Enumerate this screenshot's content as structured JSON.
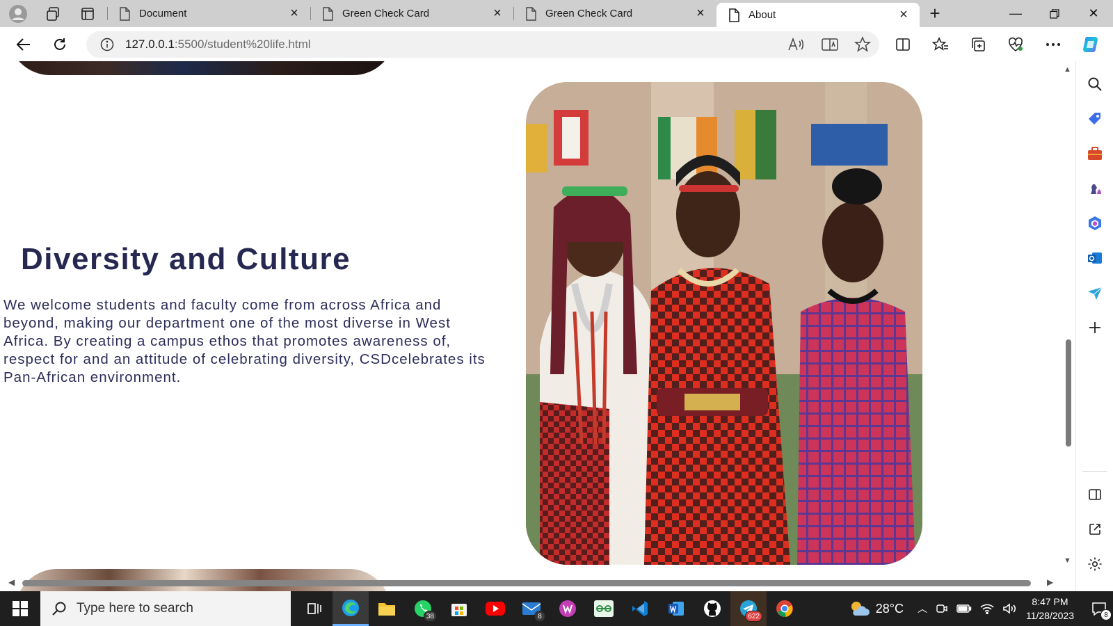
{
  "browser": {
    "tabs": [
      {
        "label": "Document",
        "active": false
      },
      {
        "label": "Green Check Card",
        "active": false
      },
      {
        "label": "Green Check Card",
        "active": false
      },
      {
        "label": "About",
        "active": true
      }
    ],
    "url_main": "127.0.0.1",
    "url_path": ":5500/student%20life.html",
    "icons": {
      "back": "back-arrow-icon",
      "refresh": "refresh-icon",
      "info": "info-icon",
      "read_aloud": "read-aloud-icon",
      "immersive_reader": "immersive-reader-icon",
      "favorite": "star-icon",
      "split_screen": "split-screen-icon",
      "favorites": "favorites-icon",
      "collections": "collections-icon",
      "browser_essentials": "heart-pulse-icon",
      "more": "more-icon",
      "copilot": "copilot-icon"
    }
  },
  "page": {
    "section_title": "Diversity and Culture",
    "section_text": "We welcome students and faculty come from across Africa and beyond, making our department one of the most diverse in West Africa. By creating a campus ethos that promotes awareness of, respect for and an attitude of celebrating diversity, CSDcelebrates its Pan-African environment."
  },
  "taskbar": {
    "search_placeholder": "Type here to search",
    "badges": {
      "whatsapp": "38",
      "mail": "8",
      "telegram": "622",
      "notifications": "8"
    },
    "weather": "28°C",
    "time": "8:47 PM",
    "date": "11/28/2023"
  },
  "colors": {
    "title": "#272851",
    "body_text": "#2d2d5a",
    "tabstrip": "#cfcfcf",
    "taskbar": "#1f1f1f"
  }
}
